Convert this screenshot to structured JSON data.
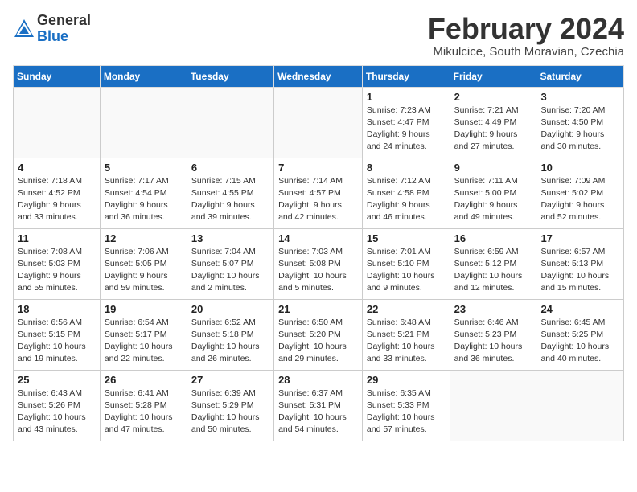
{
  "header": {
    "logo_general": "General",
    "logo_blue": "Blue",
    "month_year": "February 2024",
    "location": "Mikulcice, South Moravian, Czechia"
  },
  "days_of_week": [
    "Sunday",
    "Monday",
    "Tuesday",
    "Wednesday",
    "Thursday",
    "Friday",
    "Saturday"
  ],
  "weeks": [
    [
      {
        "day": "",
        "detail": ""
      },
      {
        "day": "",
        "detail": ""
      },
      {
        "day": "",
        "detail": ""
      },
      {
        "day": "",
        "detail": ""
      },
      {
        "day": "1",
        "detail": "Sunrise: 7:23 AM\nSunset: 4:47 PM\nDaylight: 9 hours\nand 24 minutes."
      },
      {
        "day": "2",
        "detail": "Sunrise: 7:21 AM\nSunset: 4:49 PM\nDaylight: 9 hours\nand 27 minutes."
      },
      {
        "day": "3",
        "detail": "Sunrise: 7:20 AM\nSunset: 4:50 PM\nDaylight: 9 hours\nand 30 minutes."
      }
    ],
    [
      {
        "day": "4",
        "detail": "Sunrise: 7:18 AM\nSunset: 4:52 PM\nDaylight: 9 hours\nand 33 minutes."
      },
      {
        "day": "5",
        "detail": "Sunrise: 7:17 AM\nSunset: 4:54 PM\nDaylight: 9 hours\nand 36 minutes."
      },
      {
        "day": "6",
        "detail": "Sunrise: 7:15 AM\nSunset: 4:55 PM\nDaylight: 9 hours\nand 39 minutes."
      },
      {
        "day": "7",
        "detail": "Sunrise: 7:14 AM\nSunset: 4:57 PM\nDaylight: 9 hours\nand 42 minutes."
      },
      {
        "day": "8",
        "detail": "Sunrise: 7:12 AM\nSunset: 4:58 PM\nDaylight: 9 hours\nand 46 minutes."
      },
      {
        "day": "9",
        "detail": "Sunrise: 7:11 AM\nSunset: 5:00 PM\nDaylight: 9 hours\nand 49 minutes."
      },
      {
        "day": "10",
        "detail": "Sunrise: 7:09 AM\nSunset: 5:02 PM\nDaylight: 9 hours\nand 52 minutes."
      }
    ],
    [
      {
        "day": "11",
        "detail": "Sunrise: 7:08 AM\nSunset: 5:03 PM\nDaylight: 9 hours\nand 55 minutes."
      },
      {
        "day": "12",
        "detail": "Sunrise: 7:06 AM\nSunset: 5:05 PM\nDaylight: 9 hours\nand 59 minutes."
      },
      {
        "day": "13",
        "detail": "Sunrise: 7:04 AM\nSunset: 5:07 PM\nDaylight: 10 hours\nand 2 minutes."
      },
      {
        "day": "14",
        "detail": "Sunrise: 7:03 AM\nSunset: 5:08 PM\nDaylight: 10 hours\nand 5 minutes."
      },
      {
        "day": "15",
        "detail": "Sunrise: 7:01 AM\nSunset: 5:10 PM\nDaylight: 10 hours\nand 9 minutes."
      },
      {
        "day": "16",
        "detail": "Sunrise: 6:59 AM\nSunset: 5:12 PM\nDaylight: 10 hours\nand 12 minutes."
      },
      {
        "day": "17",
        "detail": "Sunrise: 6:57 AM\nSunset: 5:13 PM\nDaylight: 10 hours\nand 15 minutes."
      }
    ],
    [
      {
        "day": "18",
        "detail": "Sunrise: 6:56 AM\nSunset: 5:15 PM\nDaylight: 10 hours\nand 19 minutes."
      },
      {
        "day": "19",
        "detail": "Sunrise: 6:54 AM\nSunset: 5:17 PM\nDaylight: 10 hours\nand 22 minutes."
      },
      {
        "day": "20",
        "detail": "Sunrise: 6:52 AM\nSunset: 5:18 PM\nDaylight: 10 hours\nand 26 minutes."
      },
      {
        "day": "21",
        "detail": "Sunrise: 6:50 AM\nSunset: 5:20 PM\nDaylight: 10 hours\nand 29 minutes."
      },
      {
        "day": "22",
        "detail": "Sunrise: 6:48 AM\nSunset: 5:21 PM\nDaylight: 10 hours\nand 33 minutes."
      },
      {
        "day": "23",
        "detail": "Sunrise: 6:46 AM\nSunset: 5:23 PM\nDaylight: 10 hours\nand 36 minutes."
      },
      {
        "day": "24",
        "detail": "Sunrise: 6:45 AM\nSunset: 5:25 PM\nDaylight: 10 hours\nand 40 minutes."
      }
    ],
    [
      {
        "day": "25",
        "detail": "Sunrise: 6:43 AM\nSunset: 5:26 PM\nDaylight: 10 hours\nand 43 minutes."
      },
      {
        "day": "26",
        "detail": "Sunrise: 6:41 AM\nSunset: 5:28 PM\nDaylight: 10 hours\nand 47 minutes."
      },
      {
        "day": "27",
        "detail": "Sunrise: 6:39 AM\nSunset: 5:29 PM\nDaylight: 10 hours\nand 50 minutes."
      },
      {
        "day": "28",
        "detail": "Sunrise: 6:37 AM\nSunset: 5:31 PM\nDaylight: 10 hours\nand 54 minutes."
      },
      {
        "day": "29",
        "detail": "Sunrise: 6:35 AM\nSunset: 5:33 PM\nDaylight: 10 hours\nand 57 minutes."
      },
      {
        "day": "",
        "detail": ""
      },
      {
        "day": "",
        "detail": ""
      }
    ]
  ]
}
